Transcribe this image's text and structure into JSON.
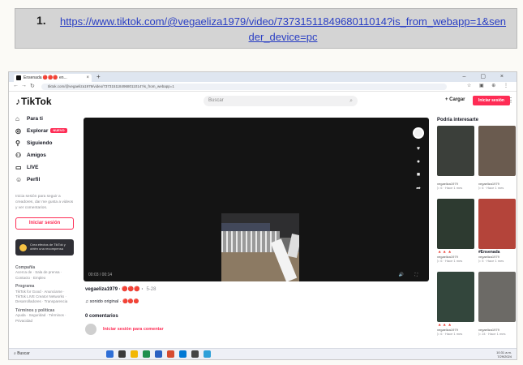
{
  "document": {
    "item_number": "1.",
    "url": "https://www.tiktok.com/@vegaeliza1979/video/7373151184968011014?is_from_webapp=1&sender_device=pc"
  },
  "browser": {
    "tab_title": "Ensenada 🔴🔴🔴 en...",
    "tab_close": "×",
    "new_tab": "+",
    "window_controls": "– ▢ ×",
    "address": "tiktok.com/@vegaeliza1979/video/7373151184968011014?is_from_webapp=1",
    "tools": "☆ ▣ ⊕ ⋮"
  },
  "tiktok": {
    "logo": "TikTok",
    "search_placeholder": "Buscar",
    "upload_label": "+ Cargar",
    "login_button": "Iniciar sesión",
    "sidebar": [
      {
        "icon": "⌂",
        "label": "Para ti"
      },
      {
        "icon": "◎",
        "label": "Explorar",
        "badge": "NUEVO"
      },
      {
        "icon": "⚲",
        "label": "Siguiendo"
      },
      {
        "icon": "⚇",
        "label": "Amigos"
      },
      {
        "icon": "▭",
        "label": "LIVE"
      },
      {
        "icon": "☺",
        "label": "Perfil"
      }
    ],
    "sidebar_hint": "Inicia sesión para seguir a creadores, dar me gusta a videos y ver comentarios.",
    "sidebar_login": "Iniciar sesión",
    "promo": "Crea efectos de TikTok y obtén una recompensa",
    "footer": [
      {
        "title": "Compañía",
        "text": "Acerca de · Sala de prensa · Contacto · Empleo"
      },
      {
        "title": "Programa",
        "text": "TikTok for Good · Anunciarse · TikTok LIVE Creator Networks · Desarrolladores · Transparencia"
      },
      {
        "title": "Términos y políticas",
        "text": "Ayuda · Seguridad · Términos · Privacidad"
      }
    ],
    "video": {
      "time": "00:03 / 00:14",
      "controls_right": "🔊 ⛶"
    },
    "author": "vegaeliza1979 · 🔴🔴🔴 ·",
    "date": "5-28",
    "sound": "♫ sonido original · 🔴🔴🔴",
    "comments_header": "0 comentarios",
    "comment_login": "Iniciar sesión para comentar",
    "suggested_header": "Podría interesarte",
    "suggested": [
      {
        "tag": "",
        "user": "vegaeliza1979",
        "meta": "▷ 6 · Hace 1 mes",
        "bg": "#3b3f3a"
      },
      {
        "tag": "",
        "user": "vegaeliza1979",
        "meta": "▷ 6 · Hace 1 mes",
        "bg": "#6a5b4f"
      },
      {
        "tag": "🔺🔺🔺",
        "user": "vegaeliza1979",
        "meta": "▷ 6 · Hace 1 mes",
        "bg": "#2d3a30"
      },
      {
        "tag": "#Ensenada",
        "user": "vegaeliza1979",
        "meta": "▷ 5 · Hace 1 mes",
        "bg": "#b4443a"
      },
      {
        "tag": "🔺🔺🔺",
        "user": "vegaeliza1979",
        "meta": "▷ 6 · Hace 1 mes",
        "bg": "#33463c"
      },
      {
        "tag": "",
        "user": "vegaeliza1979",
        "meta": "▷ 24 · Hace 1 mes",
        "bg": "#6c6a66"
      }
    ]
  },
  "taskbar": {
    "search": "⌕ Buscar",
    "tray_time": "10:31 a.m.",
    "tray_date": "7/29/2024",
    "apps": [
      "#2f6fd6",
      "#3a3a3a",
      "#f2b705",
      "#1f8f4e",
      "#2b61c1",
      "#d64b2f",
      "#0078d4",
      "#444",
      "#2ea0d8"
    ]
  }
}
